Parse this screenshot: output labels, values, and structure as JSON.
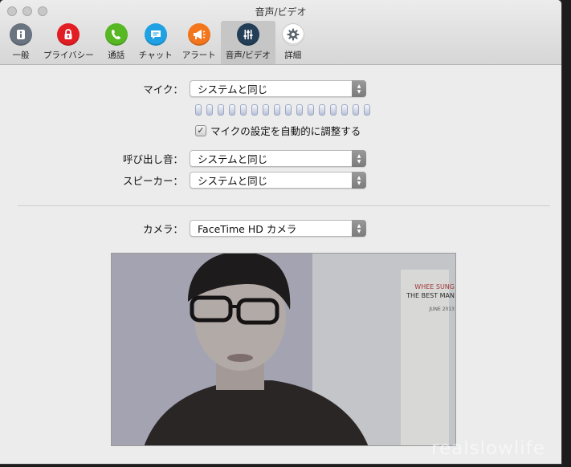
{
  "window": {
    "title": "音声/ビデオ"
  },
  "toolbar": {
    "items": [
      {
        "label": "一般",
        "icon": "info-icon",
        "color": "#6a7480"
      },
      {
        "label": "プライバシー",
        "icon": "lock-icon",
        "color": "#e21e24"
      },
      {
        "label": "通話",
        "icon": "phone-icon",
        "color": "#57b824"
      },
      {
        "label": "チャット",
        "icon": "chat-icon",
        "color": "#1fa1e4"
      },
      {
        "label": "アラート",
        "icon": "megaphone-icon",
        "color": "#f3761d"
      },
      {
        "label": "音声/ビデオ",
        "icon": "sliders-icon",
        "color": "#233e57"
      },
      {
        "label": "詳細",
        "icon": "gear-icon",
        "color": "#ffffff"
      }
    ],
    "selected_index": 5
  },
  "settings": {
    "mic": {
      "label": "マイク：",
      "value": "システムと同じ"
    },
    "mic_meter_segments": 16,
    "auto_adjust": {
      "label": "マイクの設定を自動的に調整する",
      "checked": true
    },
    "ringtone": {
      "label": "呼び出し音：",
      "value": "システムと同じ"
    },
    "speaker": {
      "label": "スピーカー：",
      "value": "システムと同じ"
    },
    "camera": {
      "label": "カメラ：",
      "value": "FaceTime HD カメラ"
    }
  },
  "preview": {
    "calendar_text": [
      "WHEE SUNG",
      "THE BEST MAN",
      "JUNE 2013"
    ]
  },
  "watermark": "realslowlife"
}
